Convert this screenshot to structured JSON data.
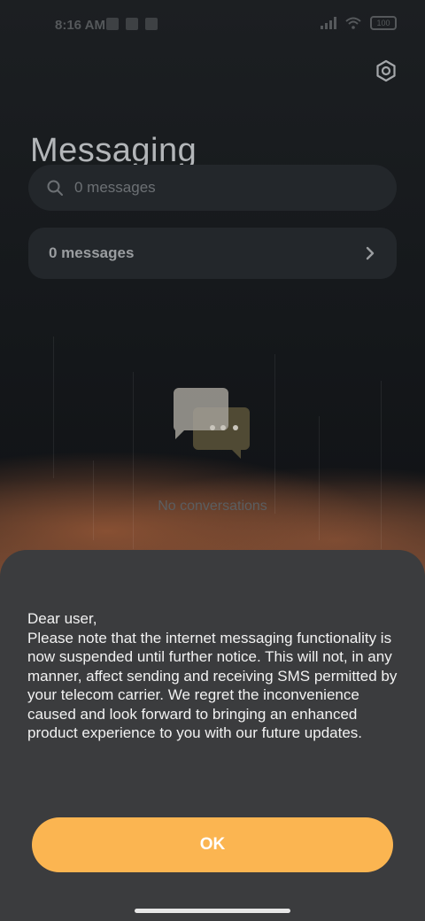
{
  "status_bar": {
    "time": "8:16 AM",
    "battery": "100"
  },
  "header": {
    "title": "Messaging",
    "settings_icon": "gear-icon"
  },
  "search": {
    "placeholder": "0 messages",
    "icon": "search-icon"
  },
  "summary": {
    "label": "0 messages",
    "icon": "chevron-right-icon"
  },
  "empty_state": {
    "text": "No conversations",
    "icon": "chat-bubbles-icon"
  },
  "dialog": {
    "paragraphs": [
      "Dear user,",
      "Please note that the internet messaging functionality is now suspended until further notice. This will not, in any manner, affect sending and receiving SMS permitted by your telecom carrier. We regret the inconvenience caused and look forward to bringing an enhanced product experience to you with our future updates."
    ],
    "ok_label": "OK"
  },
  "colors": {
    "accent": "#fbb551",
    "dialog_bg": "#3b3c3e",
    "background": "#141618"
  }
}
